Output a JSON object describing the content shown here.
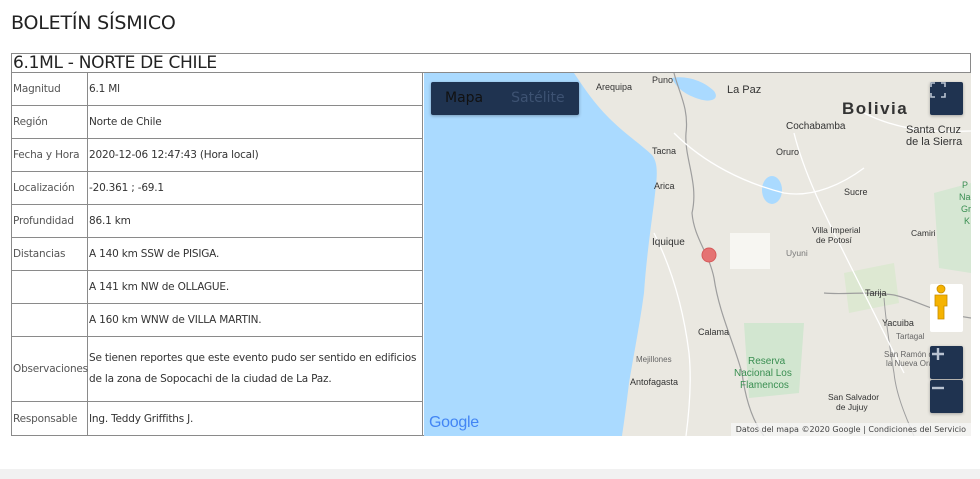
{
  "page": {
    "title": "BOLETÍN SÍSMICO"
  },
  "bulletin": {
    "heading": "6.1ML - NORTE DE CHILE",
    "rows": [
      {
        "label": "Magnitud",
        "value": "6.1 Ml"
      },
      {
        "label": "Región",
        "value": "Norte de Chile"
      },
      {
        "label": "Fecha y Hora",
        "value": "2020-12-06 12:47:43 (Hora local)"
      },
      {
        "label": "Localización",
        "value": "-20.361 ; -69.1"
      },
      {
        "label": "Profundidad",
        "value": "86.1 km"
      },
      {
        "label": "Distancias",
        "value": "A 140 km SSW de PISIGA."
      },
      {
        "label": "",
        "value": "A 141 km NW de OLLAGUE."
      },
      {
        "label": "",
        "value": "A 160 km WNW de VILLA MARTIN."
      },
      {
        "label": "Observaciones",
        "value": "Se tienen reportes que este evento pudo ser sentido en edificios de la zona de Sopocachi de la ciudad de La Paz."
      },
      {
        "label": "Responsable",
        "value": "Ing. Teddy Griffiths J."
      }
    ]
  },
  "map": {
    "map_type": {
      "map_label": "Mapa",
      "satellite_label": "Satélite",
      "selected": "Mapa"
    },
    "logo_text": "Google",
    "attribution": {
      "data": "Datos del mapa ©2020 Google",
      "terms": "Condiciones del Servicio"
    },
    "places": {
      "puno": "Puno",
      "arequipa": "Arequipa",
      "la_paz": "La Paz",
      "bolivia": "Bolivia",
      "cochabamba": "Cochabamba",
      "santa_cruz_1": "Santa Cruz",
      "santa_cruz_2": "de la Sierra",
      "tacna": "Tacna",
      "oruro": "Oruro",
      "arica": "Arica",
      "sucre": "Sucre",
      "iquique": "Iquique",
      "villa_imperial_1": "Villa Imperial",
      "villa_imperial_2": "de Potosí",
      "uyuni": "Uyuni",
      "camiri": "Camiri",
      "tarija": "Tarija",
      "yacuiba": "Yacuiba",
      "tartagal": "Tartagal",
      "calama": "Calama",
      "mejillones": "Mejillones",
      "reserva_1": "Reserva",
      "reserva_2": "Nacional Los",
      "reserva_3": "Flamencos",
      "antofagasta": "Antofagasta",
      "san_ramon_1": "San Ramón de",
      "san_ramon_2": "la Nueva Orán",
      "san_salvador_1": "San Salvador",
      "san_salvador_2": "de Jujuy",
      "right_edge_1": "P",
      "right_edge_2": "Nac",
      "right_edge_3": "Gra",
      "right_edge_4": "K"
    },
    "epicenter_color": "#e57373",
    "water_color": "#aadaff",
    "land_color": "#eae8e1"
  },
  "icons": {
    "fullscreen": "fullscreen-icon",
    "pegman": "pegman-icon",
    "zoom_in": "plus-icon",
    "zoom_out": "minus-icon"
  }
}
